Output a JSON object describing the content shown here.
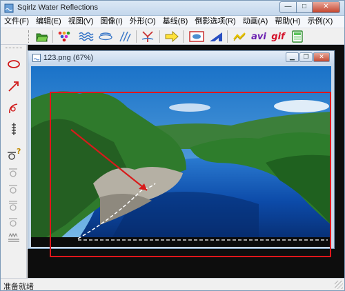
{
  "app": {
    "title": "Sqirlz Water Reflections",
    "title_buttons": {
      "minimize": "—",
      "maximize": "□",
      "close": "✕"
    }
  },
  "menu": [
    {
      "id": "file",
      "label": "文件(F)"
    },
    {
      "id": "edit",
      "label": "编辑(E)"
    },
    {
      "id": "view",
      "label": "视图(V)"
    },
    {
      "id": "image",
      "label": "图像(I)"
    },
    {
      "id": "shape",
      "label": "外形(O)"
    },
    {
      "id": "baseline",
      "label": "基线(B)"
    },
    {
      "id": "ripple",
      "label": "倒影选项(R)"
    },
    {
      "id": "animate",
      "label": "动画(A)"
    },
    {
      "id": "help",
      "label": "帮助(H)"
    },
    {
      "id": "examples",
      "label": "示例(X)"
    }
  ],
  "toolbar": {
    "buttons": [
      {
        "name": "open-icon"
      },
      {
        "name": "palette-icon"
      },
      {
        "name": "ripple-waves-icon"
      },
      {
        "name": "ripple-oval-icon"
      },
      {
        "name": "wind-lines-icon"
      },
      {
        "name": "fork-icon"
      },
      {
        "name": "arrow-right-icon"
      },
      {
        "name": "preview-icon"
      },
      {
        "name": "ruler-triangle-icon"
      },
      {
        "name": "wand-icon"
      },
      {
        "name": "avi-icon",
        "text": "avi"
      },
      {
        "name": "gif-icon",
        "text": "gif"
      },
      {
        "name": "save-frame-icon"
      }
    ]
  },
  "left_tools": [
    {
      "name": "ellipse-tool-icon"
    },
    {
      "name": "arrow-tool-icon"
    },
    {
      "name": "curve-tool-icon"
    },
    {
      "name": "spiral-tool-icon"
    },
    {
      "name": "question-tool-icon"
    },
    {
      "name": "shape-tool-1-icon"
    },
    {
      "name": "shape-tool-2-icon"
    },
    {
      "name": "shape-tool-3-icon"
    },
    {
      "name": "shape-tool-4-icon"
    },
    {
      "name": "grass-tool-icon"
    }
  ],
  "document": {
    "title": "123.png  (67%)",
    "buttons": {
      "minimize": "▁",
      "restore": "❐",
      "close": "✕"
    }
  },
  "colors": {
    "selection": "#e0161b",
    "arrow": "#d81b1b",
    "sky": "#2f8fd6",
    "water": "#0b3a8f"
  },
  "status": {
    "text": "准备就绪"
  }
}
